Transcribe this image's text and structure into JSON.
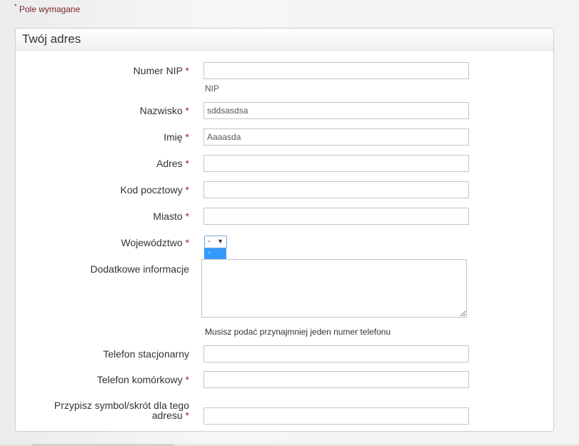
{
  "required_note": {
    "star": "*",
    "text": "Pole wymagane"
  },
  "panel": {
    "title": "Twój adres"
  },
  "fields": {
    "nip": {
      "label": "Numer NIP",
      "star": "*",
      "value": "",
      "hint": "NIP"
    },
    "lastname": {
      "label": "Nazwisko",
      "star": "*",
      "value": "sddsasdsa"
    },
    "firstname": {
      "label": "Imię",
      "star": "*",
      "value": "Aaaasda"
    },
    "address": {
      "label": "Adres",
      "star": "*",
      "value": ""
    },
    "postcode": {
      "label": "Kod pocztowy",
      "star": "*",
      "value": ""
    },
    "city": {
      "label": "Miasto",
      "star": "*",
      "value": ""
    },
    "province": {
      "label": "Województwo",
      "star": "*",
      "selected": "-",
      "open_option": "-"
    },
    "additional": {
      "label": "Dodatkowe informacje",
      "value": ""
    },
    "phone_note": "Musisz podać przynajmniej jeden numer telefonu",
    "landline": {
      "label": "Telefon stacjonarny",
      "value": ""
    },
    "mobile": {
      "label": "Telefon komórkowy",
      "star": "*",
      "value": ""
    },
    "alias": {
      "label": "Przypisz symbol/skrót dla tego adresu",
      "star": "*",
      "value": ""
    }
  },
  "colors": {
    "required": "#b01c2e",
    "note": "#7a1f2b",
    "select_highlight": "#3399ff"
  }
}
